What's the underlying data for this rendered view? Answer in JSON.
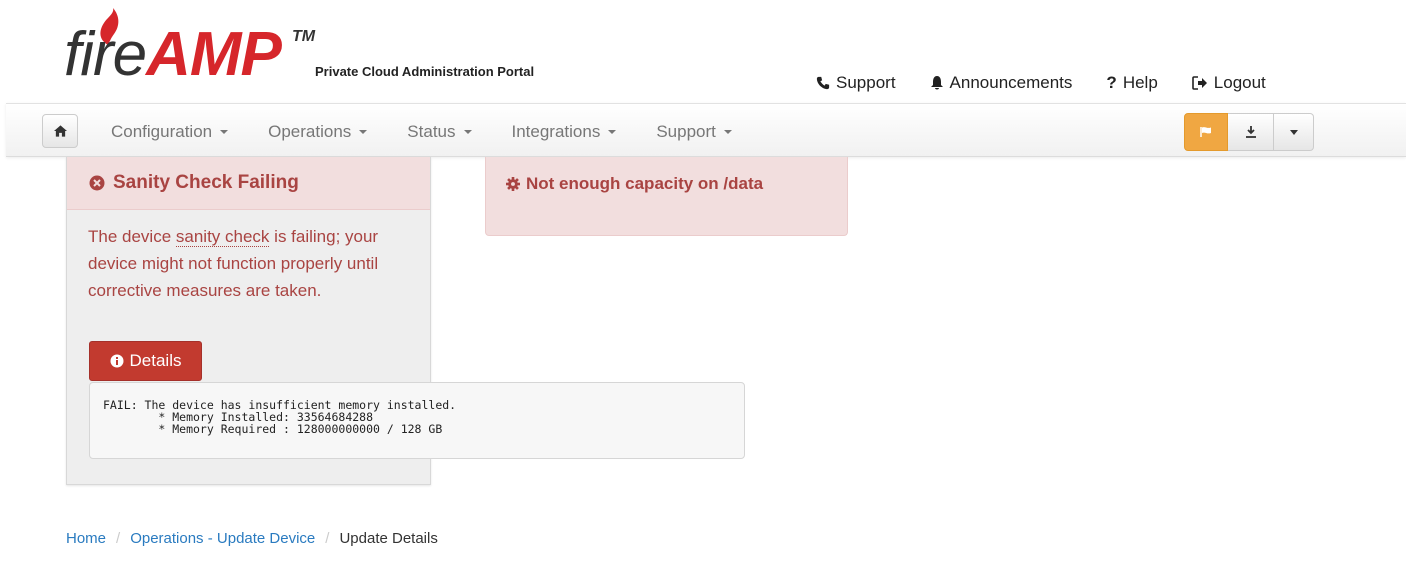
{
  "logo": {
    "fire": "fire",
    "amp": "AMP",
    "tm": "TM",
    "subtitle": "Private Cloud Administration Portal"
  },
  "top_links": {
    "support": "Support",
    "announcements": "Announcements",
    "help": "Help",
    "logout": "Logout"
  },
  "nav": {
    "items": [
      {
        "label": "Configuration"
      },
      {
        "label": "Operations"
      },
      {
        "label": "Status"
      },
      {
        "label": "Integrations"
      },
      {
        "label": "Support"
      }
    ]
  },
  "sanity_panel": {
    "title": "Sanity Check Failing",
    "body_pre": "The device ",
    "body_link": "sanity check",
    "body_post": " is failing; your device might not function properly until corrective measures are taken.",
    "details_label": "Details",
    "output": "FAIL: The device has insufficient memory installed.\n        * Memory Installed: 33564684288\n        * Memory Required : 128000000000 / 128 GB"
  },
  "capacity_panel": {
    "message": "Not enough capacity on /data"
  },
  "breadcrumb": {
    "home": "Home",
    "operations": "Operations - Update Device",
    "current": "Update Details"
  },
  "colors": {
    "danger_text": "#a94442",
    "danger_bg": "#f2dede",
    "warning_button": "#f0a742",
    "details_button": "#c23a2f",
    "link": "#2a7bc0",
    "brand_red": "#d6262b"
  },
  "icons": {
    "home": "home-icon",
    "flag": "flag-icon",
    "download": "download-icon",
    "phone": "phone-icon",
    "bell": "bell-icon",
    "logout": "logout-icon",
    "error": "times-circle-icon",
    "info": "info-circle-icon",
    "gear": "gear-icon"
  }
}
